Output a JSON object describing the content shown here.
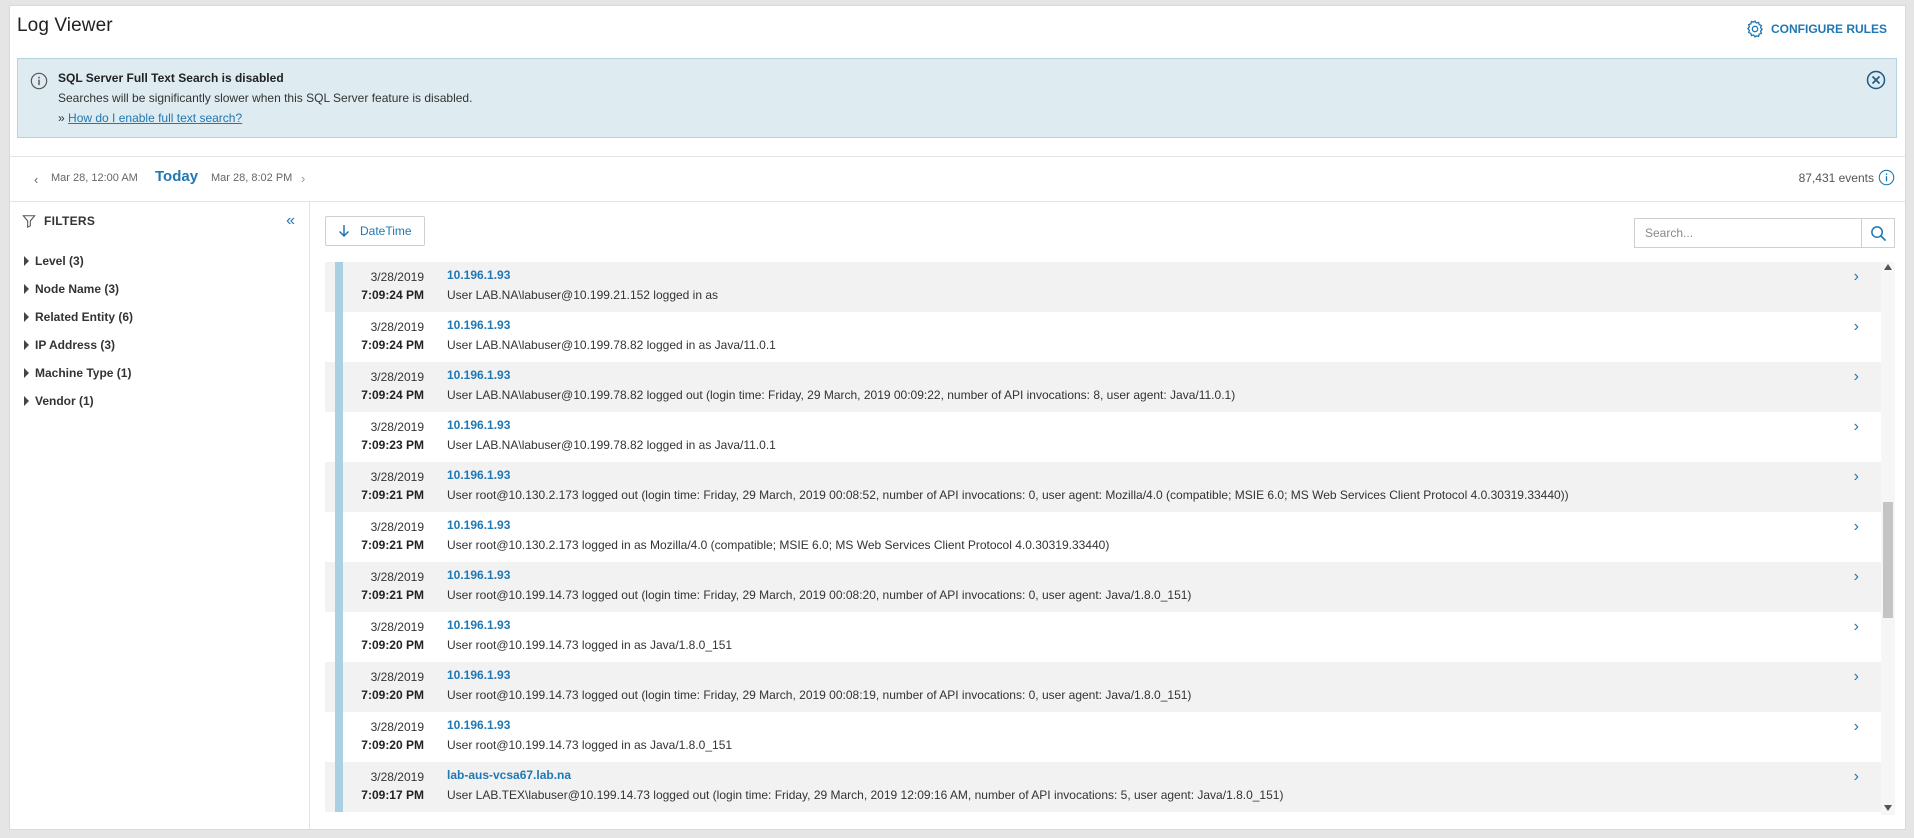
{
  "header": {
    "title": "Log Viewer",
    "configure_label": "CONFIGURE RULES"
  },
  "banner": {
    "title": "SQL Server Full Text Search is disabled",
    "text": "Searches will be significantly slower when this SQL Server feature is disabled.",
    "link_prefix": "»",
    "link_label": "How do I enable full text search?"
  },
  "datebar": {
    "start": "Mar 28, 12:00 AM",
    "current": "Today",
    "end": "Mar 28, 8:02 PM",
    "events": "87,431 events"
  },
  "filters": {
    "heading": "FILTERS",
    "items": [
      {
        "label": "Level (3)"
      },
      {
        "label": "Node Name (3)"
      },
      {
        "label": "Related Entity (6)"
      },
      {
        "label": "IP Address (3)"
      },
      {
        "label": "Machine Type (1)"
      },
      {
        "label": "Vendor (1)"
      }
    ]
  },
  "toolbar": {
    "sort_label": "DateTime",
    "search_placeholder": "Search..."
  },
  "colors": {
    "accent": "#1f78b4",
    "level_bar": "#a9d1e1",
    "banner_bg": "#deebf1"
  },
  "logs": [
    {
      "date": "3/28/2019",
      "time": "7:09:24 PM",
      "host": "10.196.1.93",
      "message": "User LAB.NA\\labuser@10.199.21.152 logged in as"
    },
    {
      "date": "3/28/2019",
      "time": "7:09:24 PM",
      "host": "10.196.1.93",
      "message": "User LAB.NA\\labuser@10.199.78.82 logged in as Java/11.0.1"
    },
    {
      "date": "3/28/2019",
      "time": "7:09:24 PM",
      "host": "10.196.1.93",
      "message": "User LAB.NA\\labuser@10.199.78.82 logged out (login time: Friday, 29 March, 2019 00:09:22, number of API invocations: 8, user agent: Java/11.0.1)"
    },
    {
      "date": "3/28/2019",
      "time": "7:09:23 PM",
      "host": "10.196.1.93",
      "message": "User LAB.NA\\labuser@10.199.78.82 logged in as Java/11.0.1"
    },
    {
      "date": "3/28/2019",
      "time": "7:09:21 PM",
      "host": "10.196.1.93",
      "message": "User root@10.130.2.173 logged out (login time: Friday, 29 March, 2019 00:08:52, number of API invocations: 0, user agent: Mozilla/4.0 (compatible; MSIE 6.0; MS Web Services Client Protocol 4.0.30319.33440))"
    },
    {
      "date": "3/28/2019",
      "time": "7:09:21 PM",
      "host": "10.196.1.93",
      "message": "User root@10.130.2.173 logged in as Mozilla/4.0 (compatible; MSIE 6.0; MS Web Services Client Protocol 4.0.30319.33440)"
    },
    {
      "date": "3/28/2019",
      "time": "7:09:21 PM",
      "host": "10.196.1.93",
      "message": "User root@10.199.14.73 logged out (login time: Friday, 29 March, 2019 00:08:20, number of API invocations: 0, user agent: Java/1.8.0_151)"
    },
    {
      "date": "3/28/2019",
      "time": "7:09:20 PM",
      "host": "10.196.1.93",
      "message": "User root@10.199.14.73 logged in as Java/1.8.0_151"
    },
    {
      "date": "3/28/2019",
      "time": "7:09:20 PM",
      "host": "10.196.1.93",
      "message": "User root@10.199.14.73 logged out (login time: Friday, 29 March, 2019 00:08:19, number of API invocations: 0, user agent: Java/1.8.0_151)"
    },
    {
      "date": "3/28/2019",
      "time": "7:09:20 PM",
      "host": "10.196.1.93",
      "message": "User root@10.199.14.73 logged in as Java/1.8.0_151"
    },
    {
      "date": "3/28/2019",
      "time": "7:09:17 PM",
      "host": "lab-aus-vcsa67.lab.na",
      "message": "User LAB.TEX\\labuser@10.199.14.73 logged out (login time: Friday, 29 March, 2019 12:09:16 AM, number of API invocations: 5, user agent: Java/1.8.0_151)"
    }
  ]
}
